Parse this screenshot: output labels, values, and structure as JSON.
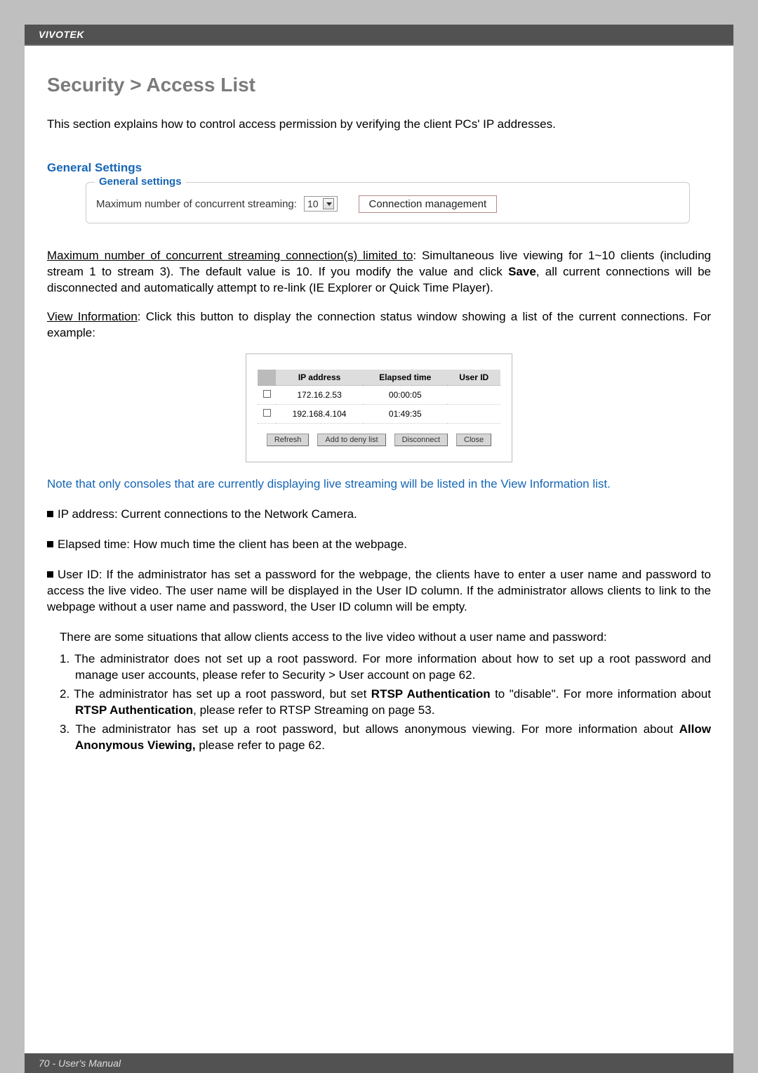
{
  "header": {
    "brand": "VIVOTEK"
  },
  "title": "Security >  Access List",
  "intro": "This section explains how to control access permission by verifying the client PCs' IP addresses.",
  "section": {
    "heading": "General Settings",
    "legend": "General settings",
    "max_label": "Maximum number of concurrent streaming:",
    "max_value": "10",
    "conn_mgmt_btn": "Connection management"
  },
  "para1": {
    "label": "Maximum number of concurrent streaming connection(s) limited to",
    "text": ": Simultaneous live viewing for 1~10 clients (including stream 1 to stream 3). The default value is 10. If you modify the value and click ",
    "save": "Save",
    "text2": ", all current connections will be disconnected and automatically attempt to re-link (IE Explorer or Quick Time Player)."
  },
  "para2": {
    "label": "View Information",
    "text": ": Click this button to display the connection status window showing a list of the current connections. For example:"
  },
  "conn_table": {
    "headers": [
      "",
      "IP address",
      "Elapsed time",
      "User ID"
    ],
    "rows": [
      {
        "ip": "172.16.2.53",
        "elapsed": "00:00:05",
        "uid": ""
      },
      {
        "ip": "192.168.4.104",
        "elapsed": "01:49:35",
        "uid": ""
      }
    ],
    "buttons": [
      "Refresh",
      "Add to deny list",
      "Disconnect",
      "Close"
    ]
  },
  "note": "Note that only consoles that are currently displaying live streaming will be listed in the View Information list.",
  "bullets": {
    "b1": "IP address: Current connections to the Network Camera.",
    "b2": "Elapsed time: How much time the client has been at the webpage.",
    "b3": "User ID: If the administrator has set a password for the webpage, the clients have to enter a user name and password to access the live video. The user name will be displayed in the User ID column. If  the administrator allows clients to link to the webpage without a user name and password, the User ID column will be empty."
  },
  "sub_intro": "There are some situations that allow clients access to the live video without a user name and password:",
  "numbered": {
    "n1": "1. The administrator does not set up a root password. For more information about how to set up a root password and manage user accounts, please refer to Security > User account on page 62.",
    "n2a": "2. The administrator has set up a root password, but set ",
    "n2b": "RTSP Authentication",
    "n2c": " to \"disable\". For more information about ",
    "n2d": "RTSP Authentication",
    "n2e": ", please refer to RTSP Streaming on page 53.",
    "n3a": "3. The administrator has set up a root password, but allows anonymous viewing. For more information about ",
    "n3b": "Allow Anonymous Viewing,",
    "n3c": " please refer to page 62."
  },
  "footer": "70 - User's Manual"
}
